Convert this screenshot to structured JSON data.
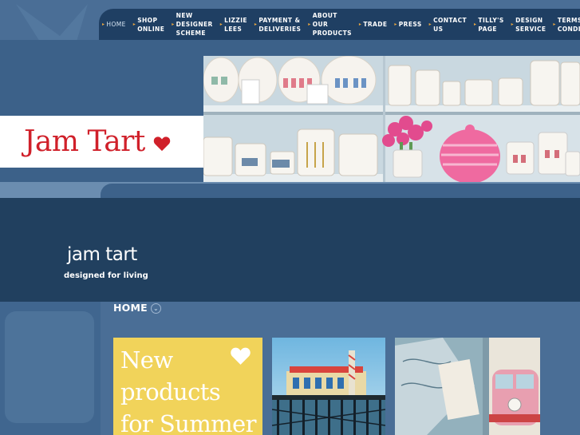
{
  "nav": {
    "items": [
      {
        "label": "HOME",
        "active": true
      },
      {
        "label": "SHOP\nONLINE"
      },
      {
        "label": "NEW\nDESIGNER\nSCHEME"
      },
      {
        "label": "LIZZIE\nLEES"
      },
      {
        "label": "PAYMENT &\nDELIVERIES"
      },
      {
        "label": "ABOUT\nOUR\nPRODUCTS"
      },
      {
        "label": "TRADE"
      },
      {
        "label": "PRESS"
      },
      {
        "label": "CONTACT\nUS"
      },
      {
        "label": "TILLY'S\nPAGE"
      },
      {
        "label": "DESIGN\nSERVICE"
      },
      {
        "label": "TERMS &\nCONDITIONS"
      }
    ]
  },
  "logo": {
    "text": "Jam Tart",
    "color": "#d0202a"
  },
  "site": {
    "name": "jam tart",
    "tagline": "designed for living"
  },
  "page": {
    "heading": "HOME"
  },
  "promo": {
    "text": "New\nproducts\nfor Summer"
  },
  "colors": {
    "nav_bg": "#1f3f63",
    "title_band": "#21405f",
    "header_bg": "#3c6189",
    "page_bg": "#4a6e96",
    "promo_bg": "#f1d35a",
    "accent_arrow": "#e8a640"
  }
}
